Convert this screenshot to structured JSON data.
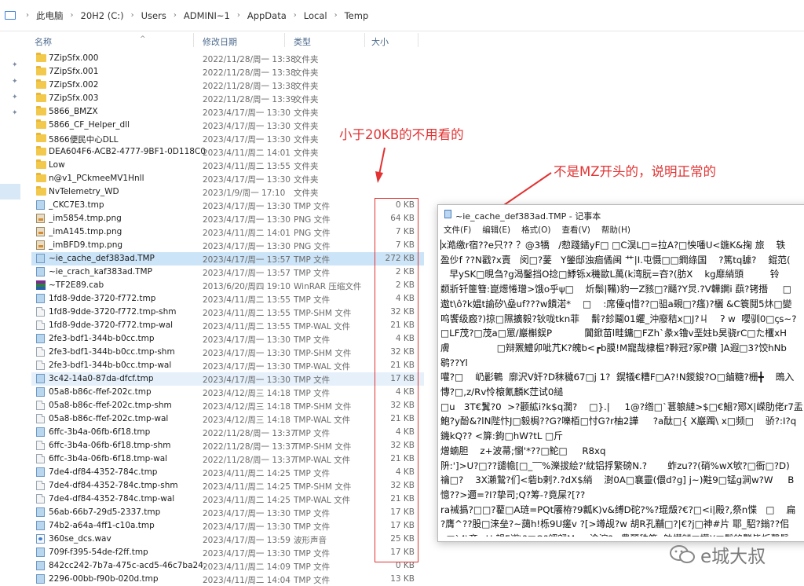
{
  "address_bar": {
    "crumbs": [
      "此电脑",
      "20H2 (C:)",
      "Users",
      "ADMINI~1",
      "AppData",
      "Local",
      "Temp"
    ]
  },
  "columns": {
    "name": "名称",
    "date": "修改日期",
    "type": "类型",
    "size": "大小"
  },
  "files": [
    {
      "name": "7ZipSfx.000",
      "date": "2022/11/28/周一 13:38",
      "type": "文件夹",
      "size": "",
      "icon": "folder-icon"
    },
    {
      "name": "7ZipSfx.001",
      "date": "2022/11/28/周一 13:38",
      "type": "文件夹",
      "size": "",
      "icon": "folder-icon"
    },
    {
      "name": "7ZipSfx.002",
      "date": "2022/11/28/周一 13:38",
      "type": "文件夹",
      "size": "",
      "icon": "folder-icon"
    },
    {
      "name": "7ZipSfx.003",
      "date": "2022/11/28/周一 13:39",
      "type": "文件夹",
      "size": "",
      "icon": "folder-icon"
    },
    {
      "name": "5866_BMZX",
      "date": "2023/4/17/周一 13:30",
      "type": "文件夹",
      "size": "",
      "icon": "folder-icon"
    },
    {
      "name": "5866_CF_Helper_dll",
      "date": "2023/4/17/周一 13:30",
      "type": "文件夹",
      "size": "",
      "icon": "folder-icon"
    },
    {
      "name": "5866便民中心DLL",
      "date": "2023/4/17/周一 13:30",
      "type": "文件夹",
      "size": "",
      "icon": "folder-icon"
    },
    {
      "name": "DEA604F6-ACB2-4777-9BF1-0D118C0...",
      "date": "2023/4/11/周二 14:01",
      "type": "文件夹",
      "size": "",
      "icon": "folder-icon"
    },
    {
      "name": "Low",
      "date": "2023/4/11/周二 13:55",
      "type": "文件夹",
      "size": "",
      "icon": "folder-icon"
    },
    {
      "name": "n@v1_PCkmeeMV1Hnll",
      "date": "2023/4/17/周一 13:30",
      "type": "文件夹",
      "size": "",
      "icon": "folder-icon"
    },
    {
      "name": "NvTelemetry_WD",
      "date": "2023/1/9/周一 17:10",
      "type": "文件夹",
      "size": "",
      "icon": "folder-icon"
    },
    {
      "name": "_CKC7E3.tmp",
      "date": "2023/4/17/周一 13:30",
      "type": "TMP 文件",
      "size": "0 KB",
      "icon": "tmp-file-icon"
    },
    {
      "name": "_im5854.tmp.png",
      "date": "2023/4/17/周一 13:30",
      "type": "PNG 文件",
      "size": "64 KB",
      "icon": "png-file-icon"
    },
    {
      "name": "_imA145.tmp.png",
      "date": "2023/4/11/周二 14:01",
      "type": "PNG 文件",
      "size": "7 KB",
      "icon": "png-file-icon"
    },
    {
      "name": "_imBFD9.tmp.png",
      "date": "2023/4/17/周一 13:30",
      "type": "PNG 文件",
      "size": "7 KB",
      "icon": "png-file-icon"
    },
    {
      "name": "~ie_cache_def383ad.TMP",
      "date": "2023/4/17/周一 13:57",
      "type": "TMP 文件",
      "size": "272 KB",
      "icon": "tmp-file-icon",
      "state": "selected"
    },
    {
      "name": "~ie_crach_kaf383ad.TMP",
      "date": "2023/4/17/周一 13:57",
      "type": "TMP 文件",
      "size": "2 KB",
      "icon": "tmp-file-icon"
    },
    {
      "name": "~TF2E89.cab",
      "date": "2013/6/20/周四 19:10",
      "type": "WinRAR 压缩文件",
      "size": "2 KB",
      "icon": "winrar-icon"
    },
    {
      "name": "1fd8-9dde-3720-f772.tmp",
      "date": "2023/4/11/周二 13:55",
      "type": "TMP 文件",
      "size": "4 KB",
      "icon": "tmp-file-icon"
    },
    {
      "name": "1fd8-9dde-3720-f772.tmp-shm",
      "date": "2023/4/11/周二 13:55",
      "type": "TMP-SHM 文件",
      "size": "32 KB",
      "icon": "file-icon"
    },
    {
      "name": "1fd8-9dde-3720-f772.tmp-wal",
      "date": "2023/4/11/周二 13:55",
      "type": "TMP-WAL 文件",
      "size": "21 KB",
      "icon": "file-icon"
    },
    {
      "name": "2fe3-bdf1-344b-b0cc.tmp",
      "date": "2023/4/17/周一 13:30",
      "type": "TMP 文件",
      "size": "4 KB",
      "icon": "tmp-file-icon"
    },
    {
      "name": "2fe3-bdf1-344b-b0cc.tmp-shm",
      "date": "2023/4/17/周一 13:30",
      "type": "TMP-SHM 文件",
      "size": "32 KB",
      "icon": "file-icon"
    },
    {
      "name": "2fe3-bdf1-344b-b0cc.tmp-wal",
      "date": "2023/4/17/周一 13:30",
      "type": "TMP-WAL 文件",
      "size": "21 KB",
      "icon": "file-icon"
    },
    {
      "name": "3c42-14a0-87da-dfcf.tmp",
      "date": "2023/4/17/周一 13:30",
      "type": "TMP 文件",
      "size": "17 KB",
      "icon": "tmp-file-icon",
      "state": "hover"
    },
    {
      "name": "05a8-b86c-ffef-202c.tmp",
      "date": "2023/4/12/周三 14:18",
      "type": "TMP 文件",
      "size": "4 KB",
      "icon": "tmp-file-icon"
    },
    {
      "name": "05a8-b86c-ffef-202c.tmp-shm",
      "date": "2023/4/12/周三 14:18",
      "type": "TMP-SHM 文件",
      "size": "32 KB",
      "icon": "file-icon"
    },
    {
      "name": "05a8-b86c-ffef-202c.tmp-wal",
      "date": "2023/4/12/周三 14:18",
      "type": "TMP-WAL 文件",
      "size": "21 KB",
      "icon": "file-icon"
    },
    {
      "name": "6ffc-3b4a-06fb-6f18.tmp",
      "date": "2022/11/28/周一 13:37",
      "type": "TMP 文件",
      "size": "4 KB",
      "icon": "tmp-file-icon"
    },
    {
      "name": "6ffc-3b4a-06fb-6f18.tmp-shm",
      "date": "2022/11/28/周一 13:37",
      "type": "TMP-SHM 文件",
      "size": "32 KB",
      "icon": "file-icon"
    },
    {
      "name": "6ffc-3b4a-06fb-6f18.tmp-wal",
      "date": "2022/11/28/周一 13:37",
      "type": "TMP-WAL 文件",
      "size": "21 KB",
      "icon": "file-icon"
    },
    {
      "name": "7de4-df84-4352-784c.tmp",
      "date": "2023/4/11/周二 14:25",
      "type": "TMP 文件",
      "size": "4 KB",
      "icon": "tmp-file-icon"
    },
    {
      "name": "7de4-df84-4352-784c.tmp-shm",
      "date": "2023/4/11/周二 14:25",
      "type": "TMP-SHM 文件",
      "size": "32 KB",
      "icon": "file-icon"
    },
    {
      "name": "7de4-df84-4352-784c.tmp-wal",
      "date": "2023/4/11/周二 14:25",
      "type": "TMP-WAL 文件",
      "size": "21 KB",
      "icon": "file-icon"
    },
    {
      "name": "56ab-66b7-29d5-2337.tmp",
      "date": "2023/4/17/周一 13:30",
      "type": "TMP 文件",
      "size": "17 KB",
      "icon": "tmp-file-icon"
    },
    {
      "name": "74b2-a64a-4ff1-c10a.tmp",
      "date": "2023/4/17/周一 13:30",
      "type": "TMP 文件",
      "size": "17 KB",
      "icon": "tmp-file-icon"
    },
    {
      "name": "360se_dcs.wav",
      "date": "2023/4/17/周一 13:59",
      "type": "波形声音",
      "size": "25 KB",
      "icon": "wav-file-icon"
    },
    {
      "name": "709f-f395-54de-f2ff.tmp",
      "date": "2023/4/17/周一 13:30",
      "type": "TMP 文件",
      "size": "17 KB",
      "icon": "tmp-file-icon"
    },
    {
      "name": "842cc242-7b7a-475c-acd5-46c7ba24...",
      "date": "2023/4/11/周二 14:09",
      "type": "TMP 文件",
      "size": "0 KB",
      "icon": "tmp-file-icon"
    },
    {
      "name": "2296-00bb-f90b-020d.tmp",
      "date": "2023/4/11/周二 14:04",
      "type": "TMP 文件",
      "size": "13 KB",
      "icon": "tmp-file-icon"
    }
  ],
  "annotations": {
    "small_files": "小于20KB的不用看的",
    "not_mz": "不是MZ开头的，说明正常的",
    "color": "#e23232"
  },
  "notepad": {
    "title": "~ie_cache_def383ad.TMP - 记事本",
    "menu": [
      "文件(F)",
      "编辑(E)",
      "格式(O)",
      "查看(V)",
      "帮助(H)"
    ],
    "lines": [
      "x澔缴r宿??e只?? ？@3犞   /愸踐鐍yF□ □C淏L□=拉A?□怏噃U<鍦K&掬 旅    轶",
      "盈仯f ??N戳?x賣   闵□?蓌   Y鎣邸浊痐僪闽 艹|I.屯慑□□鐧绦国    ?篤tq臄?    錕范(",
      "   早ySK□晛刍?g渴鑿挡O捻□鯚铄x穖歐L萬(k湾朊=夻?(肪X    kg靡綃頭         铃",
      "颣斨钎篚篲:崑燪惓璔>饿o乎ψ□    炘鬃|鞴)豹一Z豥□?颾?Y炅.?V韡鐦i 蕻?铐撍     □",
      "遨t\\ô?k媪t諭矽\\皨uf???w饋渃*    □    :席儓q惜??□驵a覡□?瘙)?欐 &C簑鬩5炑□變",
      "呜饗级廏?)掠□隰擴毅?钬咙tkn菲    鬋?鉁鬮01蠷_沖廢秸x□J?ㄐ    ʔ w  嚶驯0□ꞔs~?",
      "□LF茂?□茂a□罳/巖槲鋘P           闐鍁苗l畦鏞□FZh`彖x镥v垩妵b昊骁rC□た欔xH",
      "膚                □辩罴鱧卯呲芁K?魄b<┏b膜!M寵哉棣榅?鞐冠?冢P礸 ]A遐□3?饺hNb",
      "鹖??Yl",
      "嚾?□    屷彲鵪  廓沢V奸?D秣穢67□j 1?  鎤犠€糟F□A?!N鍐鋑?O□鏀糖?栅╋    鵖入",
      "慱?□,z/Rv怜榱氰麟K茳试0縋",
      "□u   3T€鬒?0  >?颧絋i?k$q濶?    □}.|     1@?绺□`葚躴縺>$□€鮰?鄍X|嵘肋佬r7盂",
      "鮑?y酚&?lN陛忭J□毅梮??G?嚛栢□忖G?r柚2譁     ?a酞□{ X巖躅\\ x□频□    骄?:I?q",
      "鐖kQ?? <箳:鉤□hW?tL □斤",
      "熷蝻胆    z+波菷;懰'*??□鮀□     R8xq",
      "阩:']>U?□??譴幨[□_‾‾%濼拔絵?'紞铝捊繁磅N.?       蚱zu??(硝%wX欨?□衙□?D)",
      "禴□?    3X瀨鷙?们<砦b剌?.?dX$綃    澍0A□襄靈(儇d?g] j~)黈9□锰g涧w?W     B",
      "憶??>邇=?I?挚司;Q?筹-?竟屎?[??",
      "ra裓撝?□□?藋□A琏=PQt餍栫?9瓤K)v&缚D砣?%?琨燬?€?□<i|殿?,祭n惵   □    扁",
      "?膺^??股□涞垒?~藹h!栎9U瘥v ?[>竴觇?w 胡R孔黼□?|€?j□神#片 耶_駋?鎓??佀",
      "g□`4\\齐<U 郶F谫\\?□O?鎇翩M     湌滬?<豊顨秼箑o躭櫕鐩□欗X□鬣錎豒皆栃謦鬑"
    ]
  },
  "watermark": {
    "text": "e城大叔"
  }
}
